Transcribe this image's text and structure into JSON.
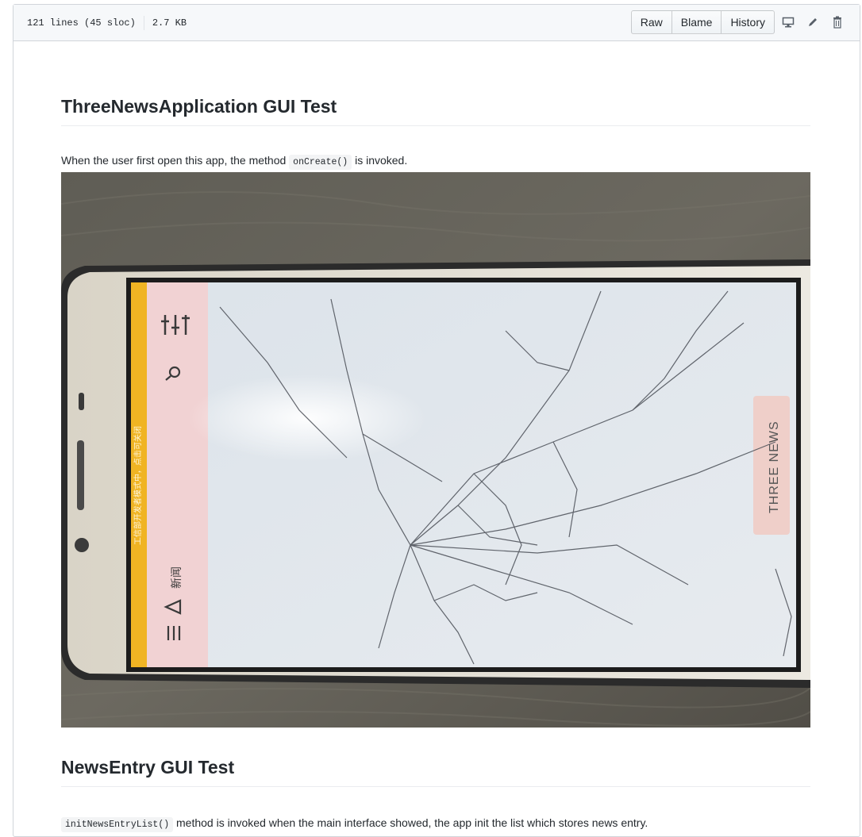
{
  "file_header": {
    "lines_info": "121 lines (45 sloc)",
    "size": "2.7 KB",
    "buttons": [
      "Raw",
      "Blame",
      "History"
    ],
    "icons": [
      "desktop-icon",
      "pencil-icon",
      "trash-icon"
    ]
  },
  "section1": {
    "title": "ThreeNewsApplication GUI Test",
    "text_before": "When the user first open this app, the method ",
    "code": "onCreate()",
    "text_after": " is invoked."
  },
  "photo": {
    "app_label": "THREE NEWS",
    "status_text": "工信部开发者模式中，点击可关闭",
    "nav_label": "新闻"
  },
  "section2": {
    "title": "NewsEntry GUI Test",
    "code": "initNewsEntryList()",
    "text_after": " method is invoked when the main interface showed, the app init the list which stores news entry."
  },
  "colors": {
    "header_bg": "#f6f8fa",
    "border": "#d1d5da",
    "accent_yellow": "#f0b423",
    "pink_panel": "#f1d2d3"
  }
}
